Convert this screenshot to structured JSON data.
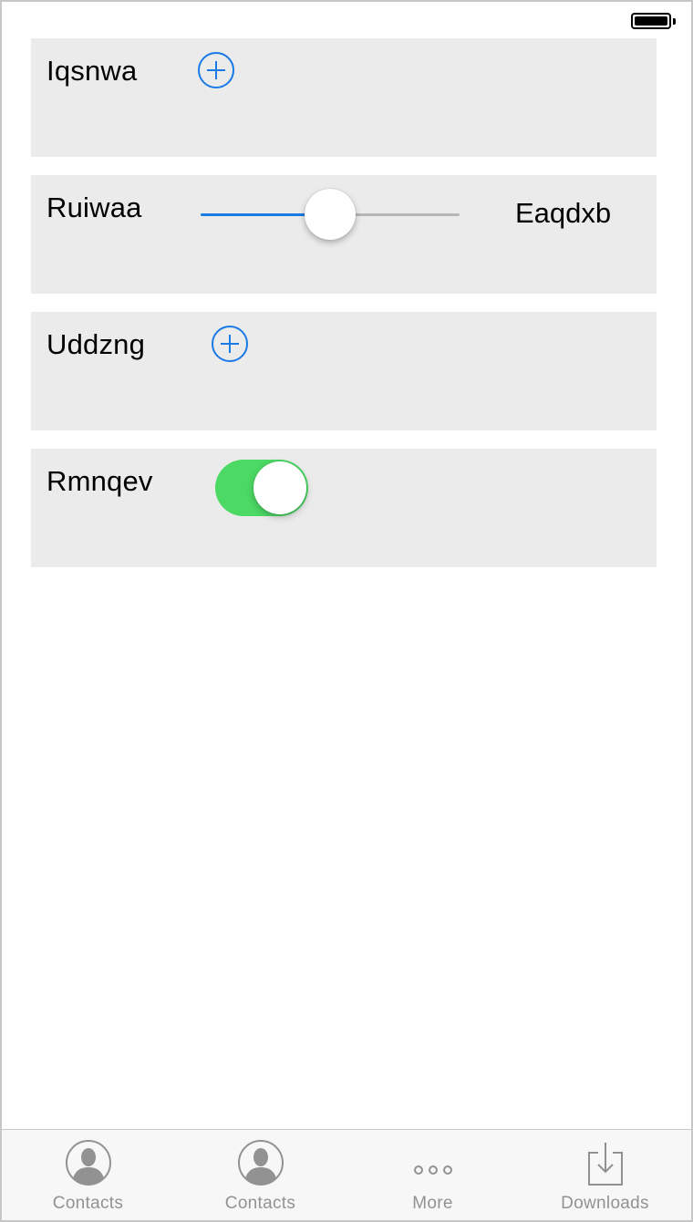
{
  "status_bar": {
    "battery_icon": "battery-full-icon"
  },
  "rows": [
    {
      "label": "Iqsnwa",
      "control": "add-button",
      "icon": "plus-circle-icon",
      "accent": "#1a7ae6"
    },
    {
      "label": "Ruiwaa",
      "control": "slider",
      "value_label": "Eaqdxb",
      "slider_value": 0.5,
      "accent": "#1a7ae6"
    },
    {
      "label": "Uddzng",
      "control": "add-button",
      "icon": "plus-circle-icon",
      "accent": "#1a7ae6"
    },
    {
      "label": "Rmnqev",
      "control": "toggle",
      "toggle_on": true,
      "accent": "#4cd964"
    }
  ],
  "tab_bar": {
    "tabs": [
      {
        "label": "Contacts",
        "icon": "contact-icon"
      },
      {
        "label": "Contacts",
        "icon": "contact-icon"
      },
      {
        "label": "More",
        "icon": "more-icon"
      },
      {
        "label": "Downloads",
        "icon": "download-icon"
      }
    ]
  }
}
